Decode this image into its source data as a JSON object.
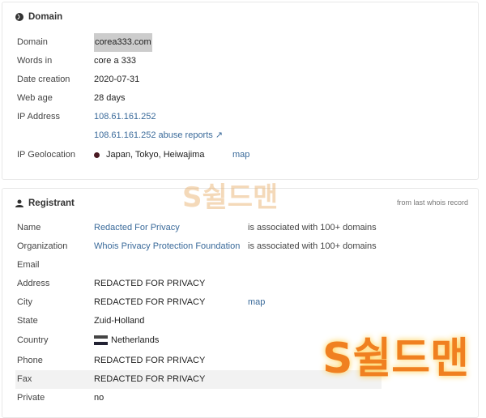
{
  "domain_section": {
    "title": "Domain",
    "icon": "globe-icon",
    "rows": [
      {
        "label": "Domain",
        "value": "corea333.com"
      },
      {
        "label": "Words in",
        "value": "core a 333"
      },
      {
        "label": "Date creation",
        "value": "2020-07-31"
      },
      {
        "label": "Web age",
        "value": "28 days"
      },
      {
        "label": "IP Address",
        "value": "108.61.161.252"
      },
      {
        "label": "",
        "value": "108.61.161.252 abuse reports"
      },
      {
        "label": "IP Geolocation",
        "value": "Japan, Tokyo, Heiwajima",
        "extra": "map"
      }
    ]
  },
  "registrant": {
    "title": "Registrant",
    "icon": "user-icon",
    "note": "from last whois record",
    "rows": [
      {
        "label": "Name",
        "value": "Redacted For Privacy",
        "extra": "is associated with 100+ domains"
      },
      {
        "label": "Organization",
        "value": "Whois Privacy Protection Foundation",
        "extra": "is associated with 100+ domains"
      },
      {
        "label": "Email",
        "value": ""
      },
      {
        "label": "Address",
        "value": "REDACTED FOR PRIVACY"
      },
      {
        "label": "City",
        "value": "REDACTED FOR PRIVACY",
        "extra": "map"
      },
      {
        "label": "State",
        "value": "Zuid-Holland"
      },
      {
        "label": "Country",
        "value": "Netherlands"
      },
      {
        "label": "Phone",
        "value": "REDACTED FOR PRIVACY"
      },
      {
        "label": "Fax",
        "value": "REDACTED FOR PRIVACY"
      },
      {
        "label": "Private",
        "value": "no"
      }
    ]
  },
  "watermark": "S쉴드맨"
}
